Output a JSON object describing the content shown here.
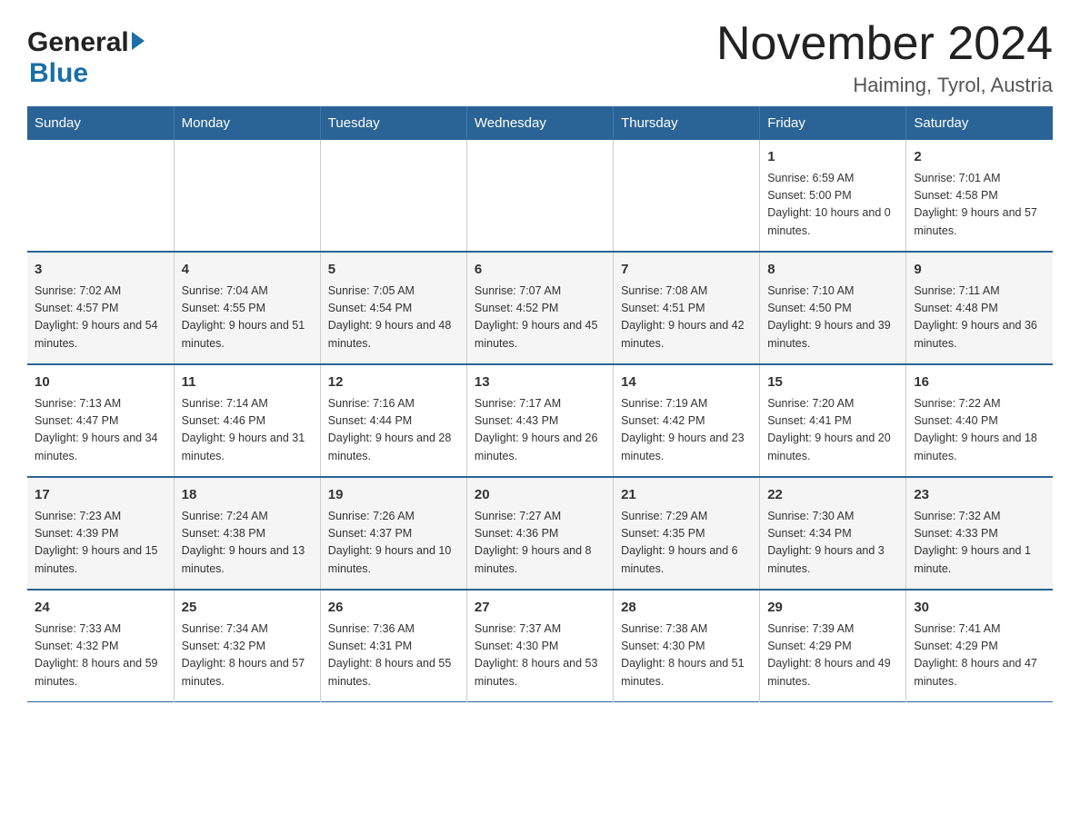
{
  "logo": {
    "general": "General",
    "blue": "Blue"
  },
  "header": {
    "title": "November 2024",
    "subtitle": "Haiming, Tyrol, Austria"
  },
  "weekdays": [
    "Sunday",
    "Monday",
    "Tuesday",
    "Wednesday",
    "Thursday",
    "Friday",
    "Saturday"
  ],
  "weeks": [
    [
      {
        "day": "",
        "info": ""
      },
      {
        "day": "",
        "info": ""
      },
      {
        "day": "",
        "info": ""
      },
      {
        "day": "",
        "info": ""
      },
      {
        "day": "",
        "info": ""
      },
      {
        "day": "1",
        "info": "Sunrise: 6:59 AM\nSunset: 5:00 PM\nDaylight: 10 hours and 0 minutes."
      },
      {
        "day": "2",
        "info": "Sunrise: 7:01 AM\nSunset: 4:58 PM\nDaylight: 9 hours and 57 minutes."
      }
    ],
    [
      {
        "day": "3",
        "info": "Sunrise: 7:02 AM\nSunset: 4:57 PM\nDaylight: 9 hours and 54 minutes."
      },
      {
        "day": "4",
        "info": "Sunrise: 7:04 AM\nSunset: 4:55 PM\nDaylight: 9 hours and 51 minutes."
      },
      {
        "day": "5",
        "info": "Sunrise: 7:05 AM\nSunset: 4:54 PM\nDaylight: 9 hours and 48 minutes."
      },
      {
        "day": "6",
        "info": "Sunrise: 7:07 AM\nSunset: 4:52 PM\nDaylight: 9 hours and 45 minutes."
      },
      {
        "day": "7",
        "info": "Sunrise: 7:08 AM\nSunset: 4:51 PM\nDaylight: 9 hours and 42 minutes."
      },
      {
        "day": "8",
        "info": "Sunrise: 7:10 AM\nSunset: 4:50 PM\nDaylight: 9 hours and 39 minutes."
      },
      {
        "day": "9",
        "info": "Sunrise: 7:11 AM\nSunset: 4:48 PM\nDaylight: 9 hours and 36 minutes."
      }
    ],
    [
      {
        "day": "10",
        "info": "Sunrise: 7:13 AM\nSunset: 4:47 PM\nDaylight: 9 hours and 34 minutes."
      },
      {
        "day": "11",
        "info": "Sunrise: 7:14 AM\nSunset: 4:46 PM\nDaylight: 9 hours and 31 minutes."
      },
      {
        "day": "12",
        "info": "Sunrise: 7:16 AM\nSunset: 4:44 PM\nDaylight: 9 hours and 28 minutes."
      },
      {
        "day": "13",
        "info": "Sunrise: 7:17 AM\nSunset: 4:43 PM\nDaylight: 9 hours and 26 minutes."
      },
      {
        "day": "14",
        "info": "Sunrise: 7:19 AM\nSunset: 4:42 PM\nDaylight: 9 hours and 23 minutes."
      },
      {
        "day": "15",
        "info": "Sunrise: 7:20 AM\nSunset: 4:41 PM\nDaylight: 9 hours and 20 minutes."
      },
      {
        "day": "16",
        "info": "Sunrise: 7:22 AM\nSunset: 4:40 PM\nDaylight: 9 hours and 18 minutes."
      }
    ],
    [
      {
        "day": "17",
        "info": "Sunrise: 7:23 AM\nSunset: 4:39 PM\nDaylight: 9 hours and 15 minutes."
      },
      {
        "day": "18",
        "info": "Sunrise: 7:24 AM\nSunset: 4:38 PM\nDaylight: 9 hours and 13 minutes."
      },
      {
        "day": "19",
        "info": "Sunrise: 7:26 AM\nSunset: 4:37 PM\nDaylight: 9 hours and 10 minutes."
      },
      {
        "day": "20",
        "info": "Sunrise: 7:27 AM\nSunset: 4:36 PM\nDaylight: 9 hours and 8 minutes."
      },
      {
        "day": "21",
        "info": "Sunrise: 7:29 AM\nSunset: 4:35 PM\nDaylight: 9 hours and 6 minutes."
      },
      {
        "day": "22",
        "info": "Sunrise: 7:30 AM\nSunset: 4:34 PM\nDaylight: 9 hours and 3 minutes."
      },
      {
        "day": "23",
        "info": "Sunrise: 7:32 AM\nSunset: 4:33 PM\nDaylight: 9 hours and 1 minute."
      }
    ],
    [
      {
        "day": "24",
        "info": "Sunrise: 7:33 AM\nSunset: 4:32 PM\nDaylight: 8 hours and 59 minutes."
      },
      {
        "day": "25",
        "info": "Sunrise: 7:34 AM\nSunset: 4:32 PM\nDaylight: 8 hours and 57 minutes."
      },
      {
        "day": "26",
        "info": "Sunrise: 7:36 AM\nSunset: 4:31 PM\nDaylight: 8 hours and 55 minutes."
      },
      {
        "day": "27",
        "info": "Sunrise: 7:37 AM\nSunset: 4:30 PM\nDaylight: 8 hours and 53 minutes."
      },
      {
        "day": "28",
        "info": "Sunrise: 7:38 AM\nSunset: 4:30 PM\nDaylight: 8 hours and 51 minutes."
      },
      {
        "day": "29",
        "info": "Sunrise: 7:39 AM\nSunset: 4:29 PM\nDaylight: 8 hours and 49 minutes."
      },
      {
        "day": "30",
        "info": "Sunrise: 7:41 AM\nSunset: 4:29 PM\nDaylight: 8 hours and 47 minutes."
      }
    ]
  ]
}
